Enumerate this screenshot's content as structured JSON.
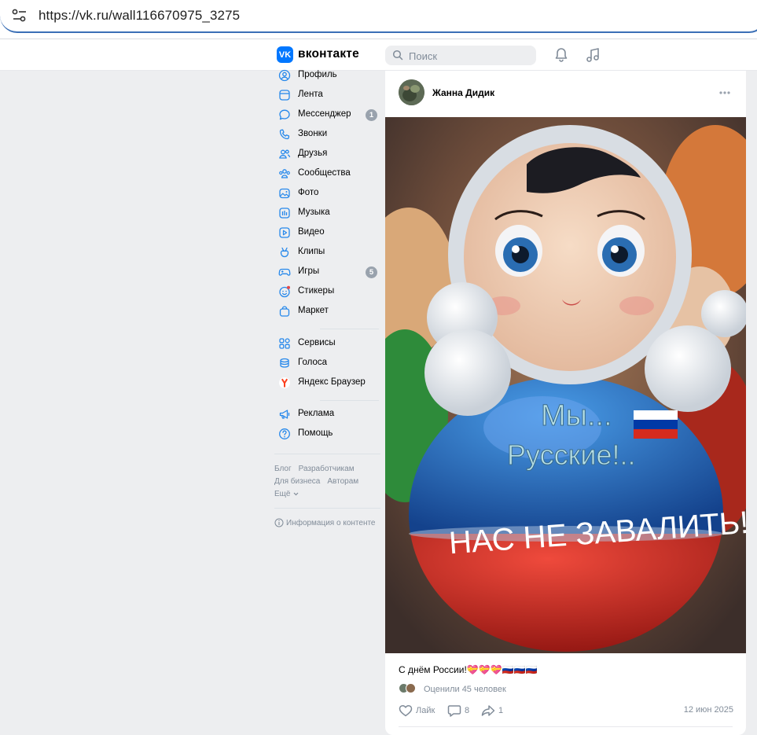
{
  "browser": {
    "url": "https://vk.ru/wall116670975_3275"
  },
  "header": {
    "logo_glyph": "VK",
    "site_name": "вконтакте",
    "search_placeholder": "Поиск",
    "accent_color": "#0077ff"
  },
  "sidebar": {
    "items": [
      {
        "label": "Профиль",
        "icon": "user-circle-icon"
      },
      {
        "label": "Лента",
        "icon": "newsfeed-icon"
      },
      {
        "label": "Мессенджер",
        "icon": "message-icon",
        "badge": "1"
      },
      {
        "label": "Звонки",
        "icon": "phone-icon"
      },
      {
        "label": "Друзья",
        "icon": "friends-icon"
      },
      {
        "label": "Сообщества",
        "icon": "communities-icon"
      },
      {
        "label": "Фото",
        "icon": "photo-icon"
      },
      {
        "label": "Музыка",
        "icon": "music-icon"
      },
      {
        "label": "Видео",
        "icon": "video-icon"
      },
      {
        "label": "Клипы",
        "icon": "clips-icon"
      },
      {
        "label": "Игры",
        "icon": "gamepad-icon",
        "badge": "5"
      },
      {
        "label": "Стикеры",
        "icon": "smile-icon"
      },
      {
        "label": "Маркет",
        "icon": "market-bag-icon"
      }
    ],
    "items2": [
      {
        "label": "Сервисы",
        "icon": "services-grid-icon"
      },
      {
        "label": "Голоса",
        "icon": "coins-icon"
      },
      {
        "label": "Яндекс Браузер",
        "icon": "yandex-browser-icon"
      }
    ],
    "items3": [
      {
        "label": "Реклама",
        "icon": "megaphone-icon"
      },
      {
        "label": "Помощь",
        "icon": "help-icon"
      }
    ],
    "footer": {
      "blog": "Блог",
      "developers": "Разработчикам",
      "business": "Для бизнеса",
      "authors": "Авторам",
      "more": "Ещё",
      "content_info": "Информация о контенте"
    }
  },
  "post": {
    "author": "Жанна Дидик",
    "image_text": {
      "line1": "Мы...",
      "line2": "Русские!..",
      "line3": "НАС НЕ ЗАВАЛИТЬ!"
    },
    "text": "С днём России!💝💝💝🇷🇺🇷🇺🇷🇺",
    "liked_by": "Оценили 45 человек",
    "like_label": "Лайк",
    "comments_count": "8",
    "shares_count": "1",
    "date": "12 июн 2025"
  }
}
